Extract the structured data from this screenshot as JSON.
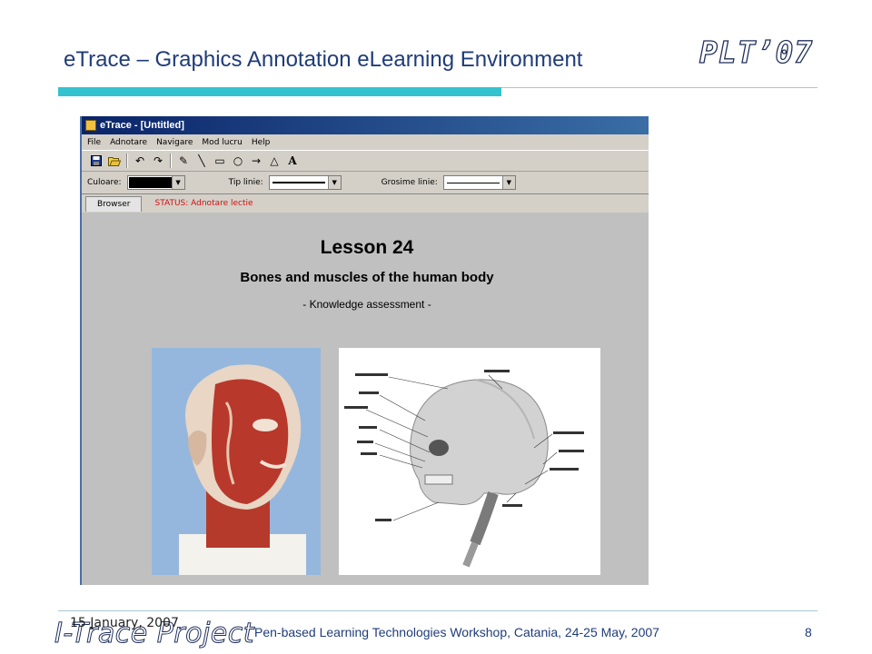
{
  "slide": {
    "title": "eTrace – Graphics Annotation eLearning Environment",
    "logo": "PLT’07",
    "footer_logo": "I-Trace Project",
    "date": "15 January, 2007",
    "footer_text": "Pen-based Learning Technologies Workshop, Catania, 24-25 May, 2007",
    "page_number": "8",
    "colors": {
      "accent": "#33c3cf",
      "title": "#1f3c7a"
    }
  },
  "app": {
    "window_title": "eTrace - [Untitled]",
    "menu": [
      "File",
      "Adnotare",
      "Navigare",
      "Mod lucru",
      "Help"
    ],
    "toolbar_icons": [
      "save-icon",
      "open-icon",
      "undo-icon",
      "redo-icon",
      "pencil-icon",
      "line-icon",
      "rectangle-icon",
      "circle-icon",
      "arrow-icon",
      "triangle-icon",
      "text-icon"
    ],
    "toolbar_glyphs": {
      "undo": "↶",
      "redo": "↷",
      "pencil": "✎",
      "line": "╲",
      "rectangle": "▭",
      "circle": "○",
      "arrow": "→",
      "triangle": "△",
      "text": "A"
    },
    "options": {
      "color_label": "Culoare:",
      "line_type_label": "Tip linie:",
      "line_width_label": "Grosime linie:"
    },
    "tab_label": "Browser",
    "status": "STATUS: Adnotare lectie",
    "lesson": {
      "title": "Lesson 24",
      "subtitle": "Bones and muscles of the human body",
      "note": "- Knowledge assessment -"
    }
  }
}
